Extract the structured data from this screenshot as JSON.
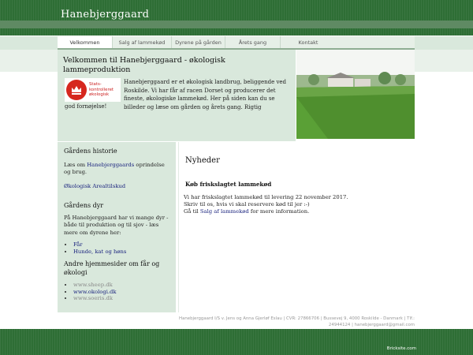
{
  "header": {
    "site_title": "Hanebjerggaard"
  },
  "nav": {
    "items": [
      {
        "label": "Velkommen",
        "active": true
      },
      {
        "label": "Salg af lammekød",
        "active": false
      },
      {
        "label": "Dyrene på gården",
        "active": false
      },
      {
        "label": "Årets gang",
        "active": false
      },
      {
        "label": "Kontakt",
        "active": false
      }
    ]
  },
  "welcome": {
    "title": "Velkommen til Hanebjerggaard - økologisk lammeproduktion",
    "logo_line1": "Stats-",
    "logo_line2": "kontrolleret",
    "logo_line3": "økologisk",
    "text_a": "Hanebjerggaard er et økologisk landbrug, beliggende ved Roskilde. Vi har får af racen Dorset og producerer det fineste, økologiske lammekød. Her på siden kan du se billeder og læse om gården og årets gang. Rigtig",
    "text_b": "god fornøjelse!"
  },
  "sidebar": {
    "history_heading": "Gårdens historie",
    "history_text_pre": "Læs om ",
    "history_link": "Hanebjerggaards",
    "history_text_post": " oprindelse og brug.",
    "areal_link": "Økologisk Arealtilskud",
    "animals_heading": "Gårdens dyr",
    "animals_text": "På Hanebjerggaard har vi mange dyr - både til produktion og til sjov - læs mere om dyrene her:",
    "animal_links": [
      "Får",
      "Hunde, kat og høns"
    ],
    "other_heading": "Andre hjemmesider om får og økologi",
    "other_links": [
      "www.sheep.dk",
      "www.okologi.dk",
      "www.soeris.dk"
    ]
  },
  "news": {
    "title": "Nyheder",
    "subtitle": "Køb friskslagtet lammekød",
    "line1": "Vi har friskslagtet lammekød til levering 22 november 2017.",
    "line2": "Skriv til os, hvis vi skal reservere kød til jer :-)",
    "line3_pre": "Gå til ",
    "line3_link": "Salg af lammekød",
    "line3_post": " for mere information."
  },
  "footer": {
    "line1": "Hanebjerggaard I/S v. Jens og Anna Gjerløf Eslau | CVR: 27866706 | Bussevej 9, 4000 Roskilde - Danmark | Tlf.:",
    "line2": "24944124 | hanebjerggaard@gmail.com",
    "credit": "Bricksite.com"
  },
  "colors": {
    "dark_green": "#2e6e35",
    "pale_green": "#d9e8dc",
    "link_blue": "#1a237e"
  }
}
